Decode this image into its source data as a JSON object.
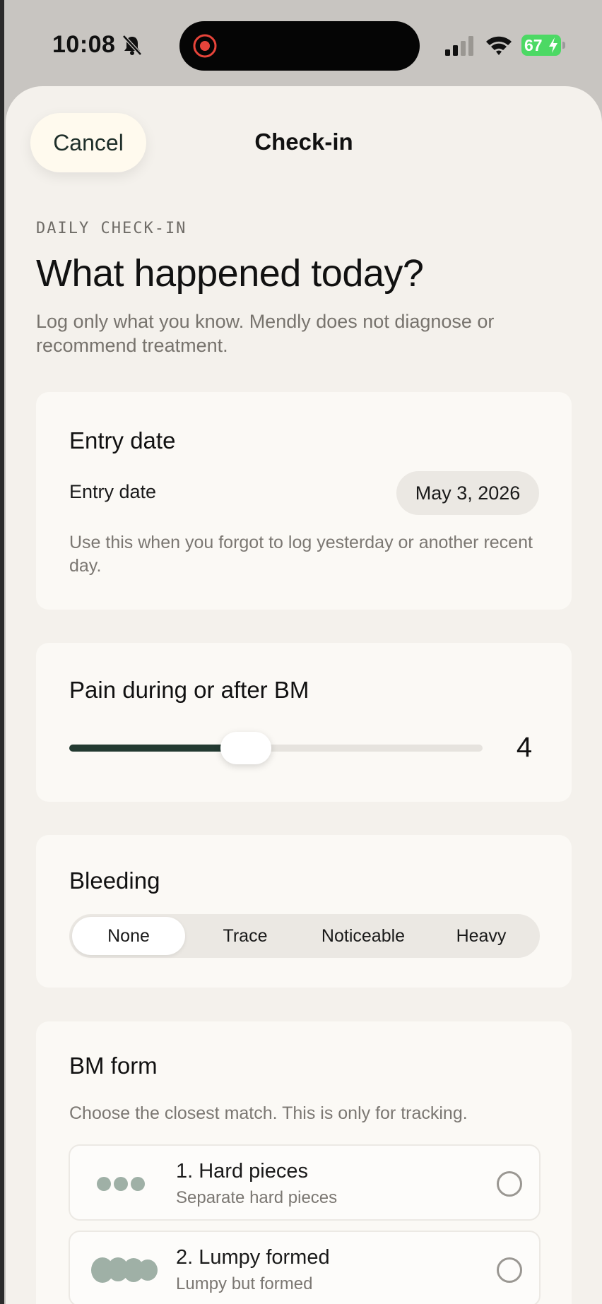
{
  "status_bar": {
    "time": "10:08",
    "battery_level": "67",
    "icons": [
      "bell-slash-icon",
      "screen-record-icon",
      "cellular-signal-icon",
      "wifi-icon",
      "battery-charging-icon"
    ]
  },
  "header": {
    "cancel_label": "Cancel",
    "title": "Check-in"
  },
  "intro": {
    "eyebrow": "DAILY CHECK-IN",
    "headline": "What happened today?",
    "description": "Log only what you know. Mendly does not diagnose or recommend treatment."
  },
  "entry_date_card": {
    "title": "Entry date",
    "row_label": "Entry date",
    "value": "May 3, 2026",
    "help": "Use this when you forgot to log yesterday or another recent day."
  },
  "pain_card": {
    "title": "Pain during or after BM",
    "value": 4,
    "value_display": "4",
    "min": 0,
    "max": 10
  },
  "bleeding_card": {
    "title": "Bleeding",
    "options": [
      "None",
      "Trace",
      "Noticeable",
      "Heavy"
    ],
    "selected": "None"
  },
  "bm_form_card": {
    "title": "BM form",
    "help": "Choose the closest match. This is only for tracking.",
    "options": [
      {
        "title": "1. Hard pieces",
        "subtitle": "Separate hard pieces",
        "icon": "hard-pieces-icon",
        "selected": false
      },
      {
        "title": "2. Lumpy formed",
        "subtitle": "Lumpy but formed",
        "icon": "lumpy-formed-icon",
        "selected": false
      }
    ]
  },
  "colors": {
    "accent": "#233a31",
    "sheet_background": "#f4f1ec",
    "card_background": "#fbf9f5",
    "stool_icon": "#9fb0a6",
    "battery": "#4cd964"
  }
}
